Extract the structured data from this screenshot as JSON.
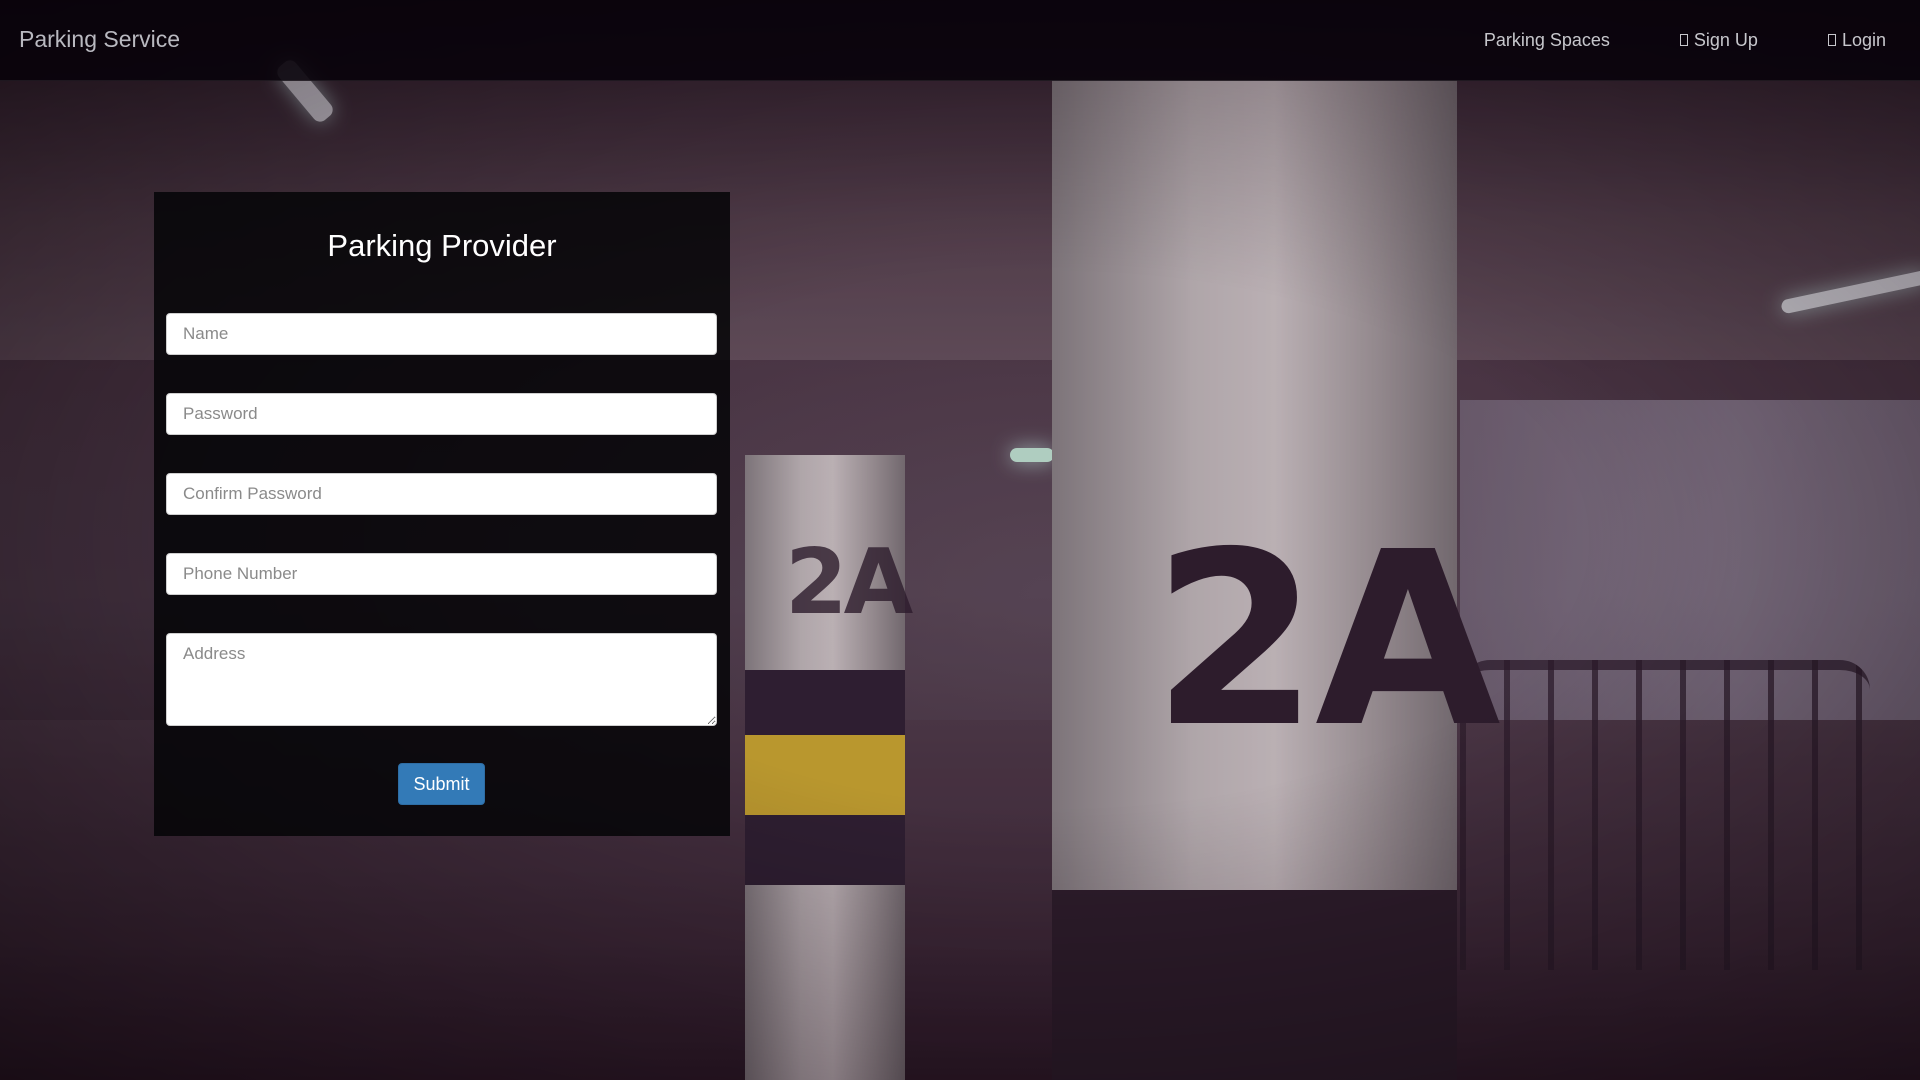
{
  "navbar": {
    "brand": "Parking Service",
    "items": [
      {
        "label": "Parking Spaces",
        "icon": null
      },
      {
        "label": "Sign Up",
        "icon": "user-icon"
      },
      {
        "label": "Login",
        "icon": "login-icon"
      }
    ]
  },
  "form": {
    "title": "Parking Provider",
    "fields": {
      "name": {
        "placeholder": "Name",
        "value": ""
      },
      "password": {
        "placeholder": "Password",
        "value": ""
      },
      "confirm_password": {
        "placeholder": "Confirm Password",
        "value": ""
      },
      "phone": {
        "placeholder": "Phone Number",
        "value": ""
      },
      "address": {
        "placeholder": "Address",
        "value": ""
      }
    },
    "submit_label": "Submit"
  },
  "background": {
    "pillar_label": "2A"
  },
  "colors": {
    "primary_button": "#337ab7",
    "navbar_bg": "#08020a",
    "panel_bg": "#050507"
  }
}
